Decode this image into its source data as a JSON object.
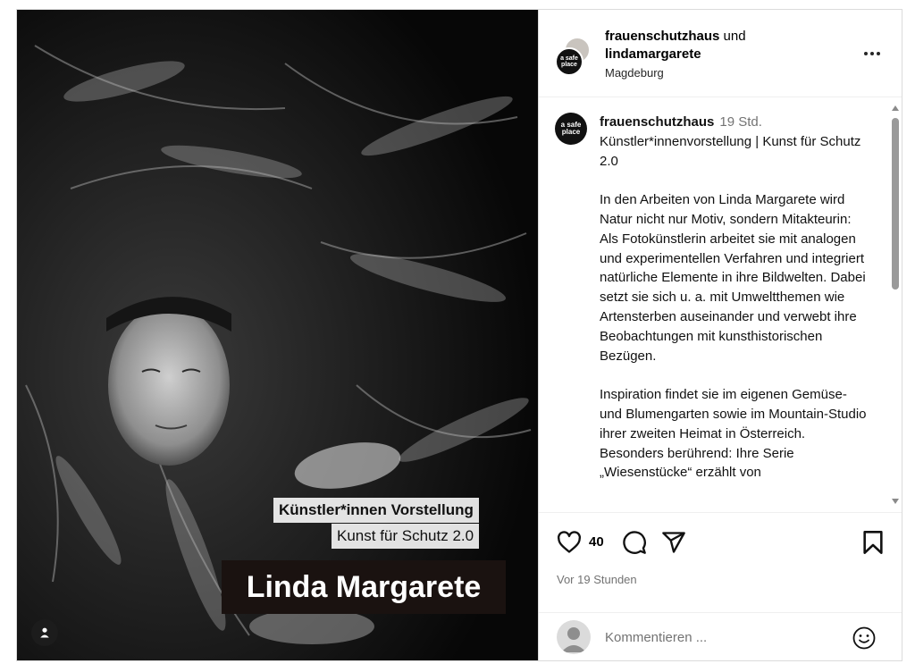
{
  "post": {
    "overlay": {
      "line1": "Künstler*innen Vorstellung",
      "line2": "Kunst für Schutz 2.0",
      "name": "Linda Margarete"
    }
  },
  "header": {
    "user1": "frauenschutzhaus",
    "connector": "und",
    "user2": "lindamargarete",
    "location": "Magdeburg",
    "avatar_text": "a safe place"
  },
  "caption": {
    "username": "frauenschutzhaus",
    "time": "19 Std.",
    "paragraphs": [
      "Künstler*innenvorstellung | Kunst für Schutz 2.0",
      "",
      "In den Arbeiten von Linda Margarete wird Natur nicht nur Motiv, sondern Mitakteurin: Als Fotokünstlerin arbeitet sie mit analogen und experimentellen Verfahren und integriert natürliche Elemente in ihre Bildwelten. Dabei setzt sie sich u. a. mit Umweltthemen wie Artensterben auseinander und verwebt ihre Beobachtungen mit kunsthistorischen Bezügen.",
      "",
      "Inspiration findet sie im eigenen Gemüse- und Blumengarten sowie im Mountain-Studio ihrer zweiten Heimat in Österreich.",
      "Besonders berührend: Ihre Serie „Wiesenstücke“ erzählt von"
    ]
  },
  "actions": {
    "likes": "40",
    "time_ago": "Vor 19 Stunden"
  },
  "comment": {
    "placeholder": "Kommentieren ..."
  },
  "icons": [
    "heart-icon",
    "comment-icon",
    "share-icon",
    "bookmark-icon",
    "more-icon",
    "emoji-icon",
    "user-tag-icon"
  ]
}
